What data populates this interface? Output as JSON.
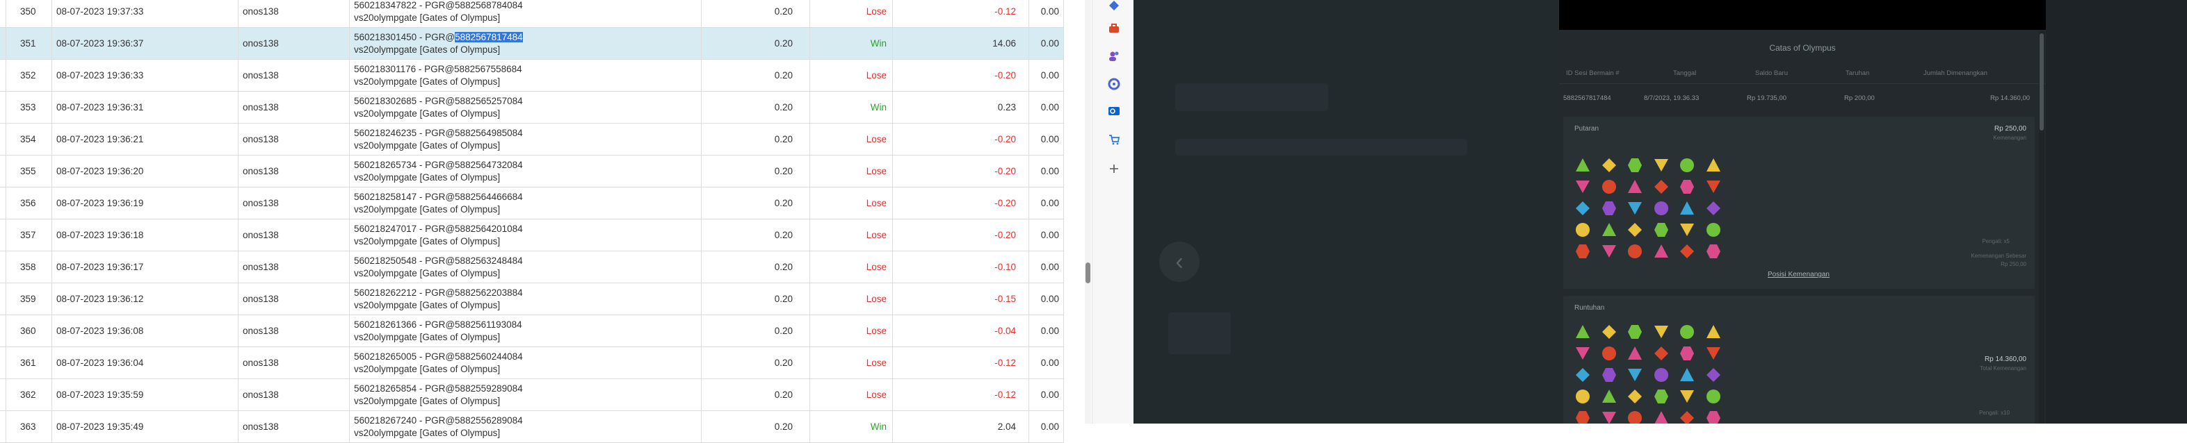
{
  "table": {
    "rows": [
      {
        "no": "350",
        "datetime": "08-07-2023 19:37:33",
        "user": "onos138",
        "desc1": "560218347822 - PGR@5882568784084",
        "desc2": "vs20olympgate [Gates of Olympus]",
        "bet": "0.20",
        "result": "Lose",
        "pl": "-0.12",
        "extra": "0.00"
      },
      {
        "no": "351",
        "datetime": "08-07-2023 19:36:37",
        "user": "onos138",
        "desc1_pre": "560218301450 - PGR@",
        "desc1_hl": "5882567817484",
        "desc2": "vs20olympgate [Gates of Olympus]",
        "bet": "0.20",
        "result": "Win",
        "pl": "14.06",
        "extra": "0.00",
        "selected": true
      },
      {
        "no": "352",
        "datetime": "08-07-2023 19:36:33",
        "user": "onos138",
        "desc1": "560218301176 - PGR@5882567558684",
        "desc2": "vs20olympgate [Gates of Olympus]",
        "bet": "0.20",
        "result": "Lose",
        "pl": "-0.20",
        "extra": "0.00"
      },
      {
        "no": "353",
        "datetime": "08-07-2023 19:36:31",
        "user": "onos138",
        "desc1": "560218302685 - PGR@5882565257084",
        "desc2": "vs20olympgate [Gates of Olympus]",
        "bet": "0.20",
        "result": "Win",
        "pl": "0.23",
        "extra": "0.00"
      },
      {
        "no": "354",
        "datetime": "08-07-2023 19:36:21",
        "user": "onos138",
        "desc1": "560218246235 - PGR@5882564985084",
        "desc2": "vs20olympgate [Gates of Olympus]",
        "bet": "0.20",
        "result": "Lose",
        "pl": "-0.20",
        "extra": "0.00"
      },
      {
        "no": "355",
        "datetime": "08-07-2023 19:36:20",
        "user": "onos138",
        "desc1": "560218265734 - PGR@5882564732084",
        "desc2": "vs20olympgate [Gates of Olympus]",
        "bet": "0.20",
        "result": "Lose",
        "pl": "-0.20",
        "extra": "0.00"
      },
      {
        "no": "356",
        "datetime": "08-07-2023 19:36:19",
        "user": "onos138",
        "desc1": "560218258147 - PGR@5882564466684",
        "desc2": "vs20olympgate [Gates of Olympus]",
        "bet": "0.20",
        "result": "Lose",
        "pl": "-0.20",
        "extra": "0.00"
      },
      {
        "no": "357",
        "datetime": "08-07-2023 19:36:18",
        "user": "onos138",
        "desc1": "560218247017 - PGR@5882564201084",
        "desc2": "vs20olympgate [Gates of Olympus]",
        "bet": "0.20",
        "result": "Lose",
        "pl": "-0.20",
        "extra": "0.00"
      },
      {
        "no": "358",
        "datetime": "08-07-2023 19:36:17",
        "user": "onos138",
        "desc1": "560218250548 - PGR@5882563248484",
        "desc2": "vs20olympgate [Gates of Olympus]",
        "bet": "0.20",
        "result": "Lose",
        "pl": "-0.10",
        "extra": "0.00"
      },
      {
        "no": "359",
        "datetime": "08-07-2023 19:36:12",
        "user": "onos138",
        "desc1": "560218262212 - PGR@5882562203884",
        "desc2": "vs20olympgate [Gates of Olympus]",
        "bet": "0.20",
        "result": "Lose",
        "pl": "-0.15",
        "extra": "0.00"
      },
      {
        "no": "360",
        "datetime": "08-07-2023 19:36:08",
        "user": "onos138",
        "desc1": "560218261366 - PGR@5882561193084",
        "desc2": "vs20olympgate [Gates of Olympus]",
        "bet": "0.20",
        "result": "Lose",
        "pl": "-0.04",
        "extra": "0.00"
      },
      {
        "no": "361",
        "datetime": "08-07-2023 19:36:04",
        "user": "onos138",
        "desc1": "560218265005 - PGR@5882560244084",
        "desc2": "vs20olympgate [Gates of Olympus]",
        "bet": "0.20",
        "result": "Lose",
        "pl": "-0.12",
        "extra": "0.00"
      },
      {
        "no": "362",
        "datetime": "08-07-2023 19:35:59",
        "user": "onos138",
        "desc1": "560218265854 - PGR@5882559289084",
        "desc2": "vs20olympgate [Gates of Olympus]",
        "bet": "0.20",
        "result": "Lose",
        "pl": "-0.12",
        "extra": "0.00"
      },
      {
        "no": "363",
        "datetime": "08-07-2023 19:35:49",
        "user": "onos138",
        "desc1": "560218267240 - PGR@5882556289084",
        "desc2": "vs20olympgate [Gates of Olympus]",
        "bet": "0.20",
        "result": "Win",
        "pl": "2.04",
        "extra": "0.00"
      }
    ]
  },
  "colors": {
    "win": "#2ba02b",
    "lose": "#e03030",
    "selected_row": "#d7ebf3",
    "highlight": "#3477d6",
    "modal_bg": "#23292c"
  },
  "side_rail": {
    "icons": [
      "diamond-icon",
      "toolbox-icon",
      "users-icon",
      "circle-app-icon",
      "outlook-icon",
      "cart-icon",
      "plus-icon"
    ]
  },
  "modal": {
    "title": "Catas of Olympus",
    "headers": [
      "ID Sesi Bermain #",
      "Tanggal",
      "Saldo Baru",
      "Taruhan",
      "Jumlah Dimenangkan"
    ],
    "summary": [
      "5882567817484",
      "8/7/2023, 19.36.33",
      "Rp 19.735,00",
      "Rp 200,00",
      "Rp 14.360,00"
    ],
    "putaran": {
      "label": "Putaran",
      "value": "Rp 250,00",
      "value_sub": "Kemenangan",
      "right_label1": "Pengali: x5",
      "right_label2": "Kemenangan Sebesar",
      "right_label3": "Rp 250,00",
      "link": "Posisi Kemenangan"
    },
    "runtuhan": {
      "label": "Runtuhan",
      "value": "Rp 14.360,00",
      "value_sub": "Total Kemenangan",
      "right_label1": "Pengali: x10"
    }
  },
  "back_icon": "chevron-left-icon"
}
